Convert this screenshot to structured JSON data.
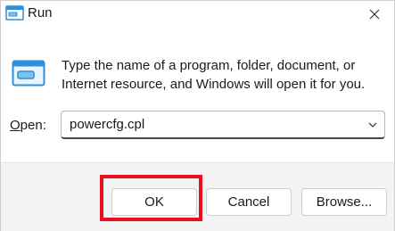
{
  "window": {
    "title": "Run",
    "close_glyph": "✕"
  },
  "icons": {
    "title_icon": "run-dialog-icon",
    "main_icon": "run-dialog-icon",
    "dropdown": "chevron-down-icon"
  },
  "description": "Type the name of a program, folder, document, or Internet resource, and Windows will open it for you.",
  "open": {
    "label_access_key": "O",
    "label_rest": "pen:",
    "value": "powercfg.cpl"
  },
  "buttons": {
    "ok": "OK",
    "cancel": "Cancel",
    "browse": "Browse..."
  },
  "colors": {
    "highlight": "#e8101e",
    "icon_blue": "#2f8fd8",
    "footer_bg": "#f3f3f3"
  }
}
